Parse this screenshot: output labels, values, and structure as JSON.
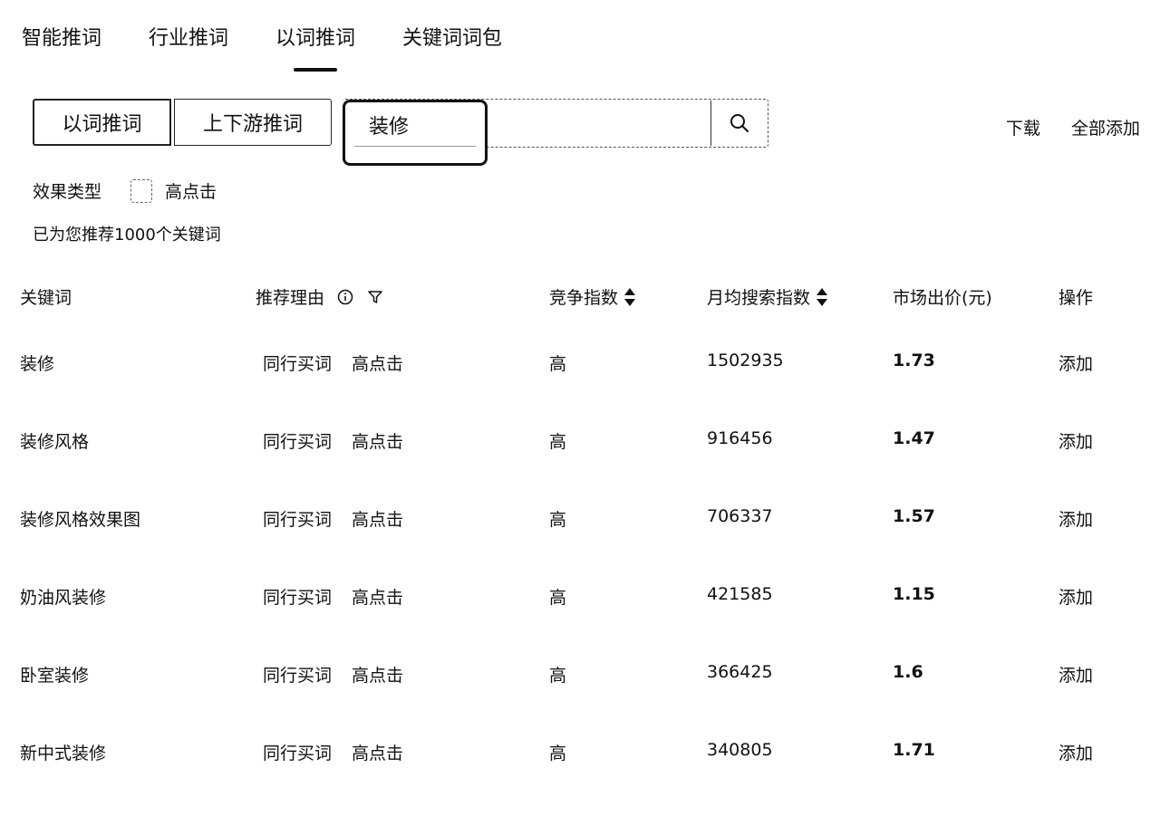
{
  "tabs": [
    {
      "label": "智能推词"
    },
    {
      "label": "行业推词"
    },
    {
      "label": "以词推词",
      "active": true
    },
    {
      "label": "关键词词包"
    }
  ],
  "mode": {
    "option1": "以词推词",
    "option2": "上下游推词"
  },
  "search": {
    "value": "装修",
    "icon": "search-icon"
  },
  "actions": {
    "download": "下载",
    "add_all": "全部添加"
  },
  "filter": {
    "label": "效果类型",
    "option": "高点击"
  },
  "summary": "已为您推荐1000个关键词",
  "table": {
    "headers": {
      "keyword": "关键词",
      "reason": "推荐理由",
      "competition": "竞争指数",
      "search": "月均搜索指数",
      "price": "市场出价(元)",
      "op": "操作"
    },
    "rows": [
      {
        "keyword": "装修",
        "tag1": "同行买词",
        "tag2": "高点击",
        "competition": "高",
        "search": "1502935",
        "price": "1.73",
        "op": "添加"
      },
      {
        "keyword": "装修风格",
        "tag1": "同行买词",
        "tag2": "高点击",
        "competition": "高",
        "search": "916456",
        "price": "1.47",
        "op": "添加"
      },
      {
        "keyword": "装修风格效果图",
        "tag1": "同行买词",
        "tag2": "高点击",
        "competition": "高",
        "search": "706337",
        "price": "1.57",
        "op": "添加"
      },
      {
        "keyword": "奶油风装修",
        "tag1": "同行买词",
        "tag2": "高点击",
        "competition": "高",
        "search": "421585",
        "price": "1.15",
        "op": "添加"
      },
      {
        "keyword": "卧室装修",
        "tag1": "同行买词",
        "tag2": "高点击",
        "competition": "高",
        "search": "366425",
        "price": "1.6",
        "op": "添加"
      },
      {
        "keyword": "新中式装修",
        "tag1": "同行买词",
        "tag2": "高点击",
        "competition": "高",
        "search": "340805",
        "price": "1.71",
        "op": "添加"
      }
    ]
  }
}
